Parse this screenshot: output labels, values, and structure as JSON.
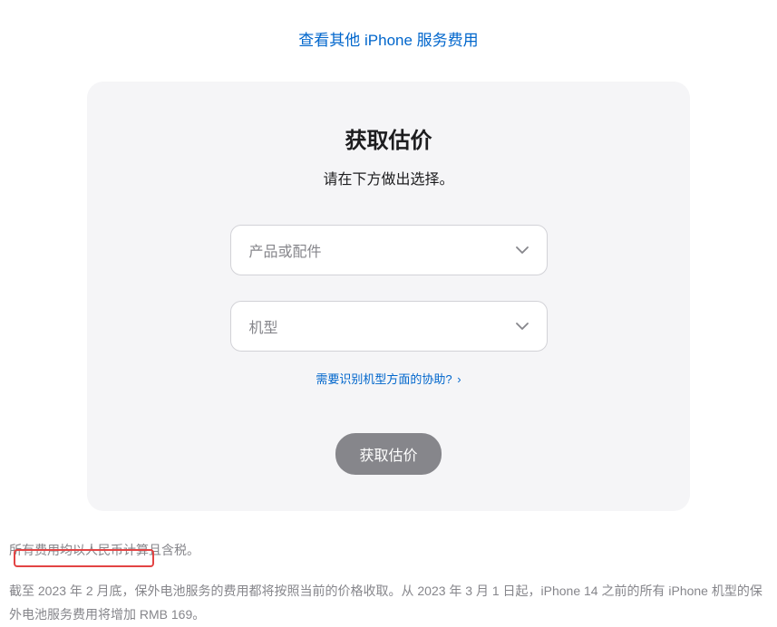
{
  "topLink": {
    "label": "查看其他 iPhone 服务费用"
  },
  "card": {
    "title": "获取估价",
    "subtitle": "请在下方做出选择。",
    "select1": {
      "placeholder": "产品或配件"
    },
    "select2": {
      "placeholder": "机型"
    },
    "helpLink": {
      "label": "需要识别机型方面的协助?"
    },
    "submitButton": {
      "label": "获取估价"
    }
  },
  "notes": {
    "line1": "所有费用均以人民币计算且含税。",
    "line2": "截至 2023 年 2 月底，保外电池服务的费用都将按照当前的价格收取。从 2023 年 3 月 1 日起，iPhone 14 之前的所有 iPhone 机型的保外电池服务费用将增加 RMB 169。"
  }
}
